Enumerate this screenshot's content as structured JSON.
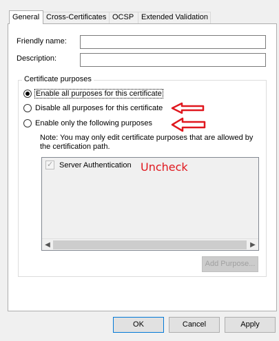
{
  "tabs": [
    {
      "label": "General",
      "active": true
    },
    {
      "label": "Cross-Certificates",
      "active": false
    },
    {
      "label": "OCSP",
      "active": false
    },
    {
      "label": "Extended Validation",
      "active": false
    }
  ],
  "fields": {
    "friendly_name": {
      "label": "Friendly name:",
      "value": ""
    },
    "description": {
      "label": "Description:",
      "value": ""
    }
  },
  "purposes": {
    "group_title": "Certificate purposes",
    "options": [
      {
        "label": "Enable all purposes for this certificate",
        "checked": true
      },
      {
        "label": "Disable all purposes for this certificate",
        "checked": false
      },
      {
        "label": "Enable only the following purposes",
        "checked": false
      }
    ],
    "note": "Note: You may only edit certificate purposes that are allowed by the certification path.",
    "list_items": [
      {
        "label": "Server Authentication",
        "checked": true,
        "enabled": false
      }
    ],
    "add_purpose_label": "Add Purpose..."
  },
  "annotation": {
    "text": "Uncheck",
    "color": "#e0171e"
  },
  "dialog_buttons": {
    "ok": "OK",
    "cancel": "Cancel",
    "apply": "Apply"
  }
}
